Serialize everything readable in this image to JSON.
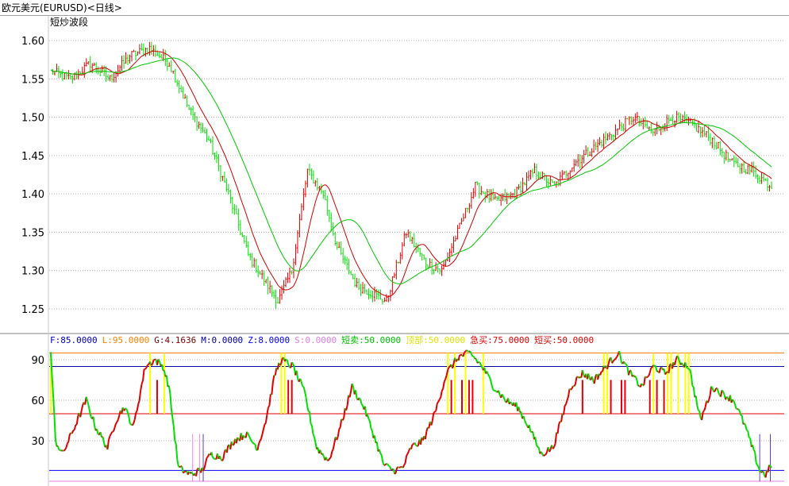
{
  "window": {
    "title": "欧元美元(EURUSD)<日线>"
  },
  "main_panel": {
    "indicator_name": "短炒波段"
  },
  "indicator_panel": {
    "legend": [
      {
        "text": "F:85.0000",
        "color": "#0000c0"
      },
      {
        "text": "L:95.0000",
        "color": "#ff8000"
      },
      {
        "text": "G:4.1636",
        "color": "#800000"
      },
      {
        "text": "M:0.0000",
        "color": "#0000a0"
      },
      {
        "text": "Z:8.0000",
        "color": "#0000ff"
      },
      {
        "text": "S:0.0000",
        "color": "#e080e0"
      },
      {
        "text": "短卖:50.0000",
        "color": "#00c000"
      },
      {
        "text": "顶部:50.0000",
        "color": "#e0e000"
      },
      {
        "text": "急买:75.0000",
        "color": "#e00000"
      },
      {
        "text": "短买:50.0000",
        "color": "#e00000"
      }
    ]
  },
  "chart_data": [
    {
      "type": "line",
      "name": "price",
      "y_ticks": [
        "1.60",
        "1.55",
        "1.50",
        "1.45",
        "1.40",
        "1.35",
        "1.30",
        "1.25"
      ],
      "ylim": [
        1.22,
        1.63
      ],
      "grid": true,
      "n_bars": 180,
      "series": [
        {
          "role": "price",
          "up_color": "#e00000",
          "down_color": "#00e000",
          "anchors": [
            [
              0,
              1.56
            ],
            [
              10,
              1.55
            ],
            [
              20,
              1.57
            ],
            [
              30,
              1.55
            ],
            [
              40,
              1.58
            ],
            [
              50,
              1.59
            ],
            [
              60,
              1.57
            ],
            [
              70,
              1.51
            ],
            [
              80,
              1.47
            ],
            [
              90,
              1.4
            ],
            [
              100,
              1.32
            ],
            [
              110,
              1.28
            ],
            [
              115,
              1.26
            ],
            [
              122,
              1.3
            ],
            [
              130,
              1.43
            ],
            [
              138,
              1.4
            ],
            [
              145,
              1.33
            ],
            [
              155,
              1.28
            ],
            [
              163,
              1.27
            ],
            [
              170,
              1.26
            ],
            [
              180,
              1.35
            ],
            [
              190,
              1.31
            ],
            [
              198,
              1.3
            ],
            [
              206,
              1.35
            ],
            [
              215,
              1.41
            ],
            [
              225,
              1.39
            ],
            [
              235,
              1.4
            ],
            [
              245,
              1.43
            ],
            [
              255,
              1.41
            ],
            [
              265,
              1.44
            ],
            [
              275,
              1.46
            ],
            [
              285,
              1.48
            ],
            [
              295,
              1.5
            ],
            [
              305,
              1.48
            ],
            [
              315,
              1.5
            ],
            [
              325,
              1.49
            ],
            [
              335,
              1.47
            ],
            [
              345,
              1.44
            ],
            [
              355,
              1.43
            ],
            [
              365,
              1.41
            ]
          ]
        },
        {
          "role": "ma-short",
          "color": "#d00000"
        },
        {
          "role": "ma-long",
          "color": "#00c800"
        }
      ]
    },
    {
      "type": "line",
      "name": "oscillator",
      "y_ticks": [
        "90",
        "60",
        "30"
      ],
      "ylim": [
        0,
        100
      ],
      "levels": [
        {
          "value": 95,
          "color": "#ff8000"
        },
        {
          "value": 85,
          "color": "#0000a0"
        },
        {
          "value": 50,
          "color": "#e00000"
        },
        {
          "value": 8,
          "color": "#0000ff"
        },
        {
          "value": 0,
          "color": "#e080e0"
        }
      ],
      "series": [
        {
          "role": "oscillator",
          "up_color": "#e00000",
          "down_color": "#00e000",
          "anchors": [
            [
              0,
              95
            ],
            [
              4,
              30
            ],
            [
              10,
              20
            ],
            [
              20,
              40
            ],
            [
              30,
              60
            ],
            [
              38,
              40
            ],
            [
              48,
              25
            ],
            [
              55,
              45
            ],
            [
              62,
              55
            ],
            [
              70,
              40
            ],
            [
              80,
              85
            ],
            [
              88,
              90
            ],
            [
              95,
              85
            ],
            [
              100,
              70
            ],
            [
              108,
              10
            ],
            [
              118,
              5
            ],
            [
              128,
              8
            ],
            [
              135,
              20
            ],
            [
              145,
              18
            ],
            [
              155,
              30
            ],
            [
              165,
              35
            ],
            [
              175,
              25
            ],
            [
              182,
              45
            ],
            [
              190,
              80
            ],
            [
              195,
              90
            ],
            [
              205,
              85
            ],
            [
              215,
              65
            ],
            [
              225,
              25
            ],
            [
              235,
              15
            ],
            [
              245,
              40
            ],
            [
              255,
              70
            ],
            [
              265,
              55
            ],
            [
              275,
              30
            ],
            [
              282,
              12
            ],
            [
              290,
              8
            ],
            [
              298,
              10
            ],
            [
              305,
              25
            ],
            [
              315,
              30
            ],
            [
              325,
              50
            ],
            [
              335,
              80
            ],
            [
              345,
              92
            ],
            [
              355,
              95
            ],
            [
              365,
              85
            ],
            [
              375,
              70
            ],
            [
              385,
              60
            ],
            [
              395,
              55
            ],
            [
              405,
              40
            ],
            [
              415,
              20
            ],
            [
              425,
              25
            ],
            [
              432,
              45
            ],
            [
              440,
              70
            ],
            [
              450,
              80
            ],
            [
              460,
              75
            ],
            [
              470,
              85
            ],
            [
              480,
              95
            ],
            [
              490,
              80
            ],
            [
              500,
              70
            ],
            [
              510,
              85
            ],
            [
              520,
              80
            ],
            [
              530,
              90
            ],
            [
              540,
              85
            ],
            [
              550,
              45
            ],
            [
              560,
              70
            ],
            [
              568,
              65
            ],
            [
              578,
              60
            ],
            [
              588,
              40
            ],
            [
              600,
              8
            ],
            [
              605,
              5
            ],
            [
              610,
              12
            ]
          ]
        },
        {
          "role": "signal-bars",
          "colors": [
            "#e00000",
            "#ffff00"
          ]
        },
        {
          "role": "spikes",
          "colors": [
            "#6040c0",
            "#ff80ff"
          ]
        }
      ]
    }
  ]
}
